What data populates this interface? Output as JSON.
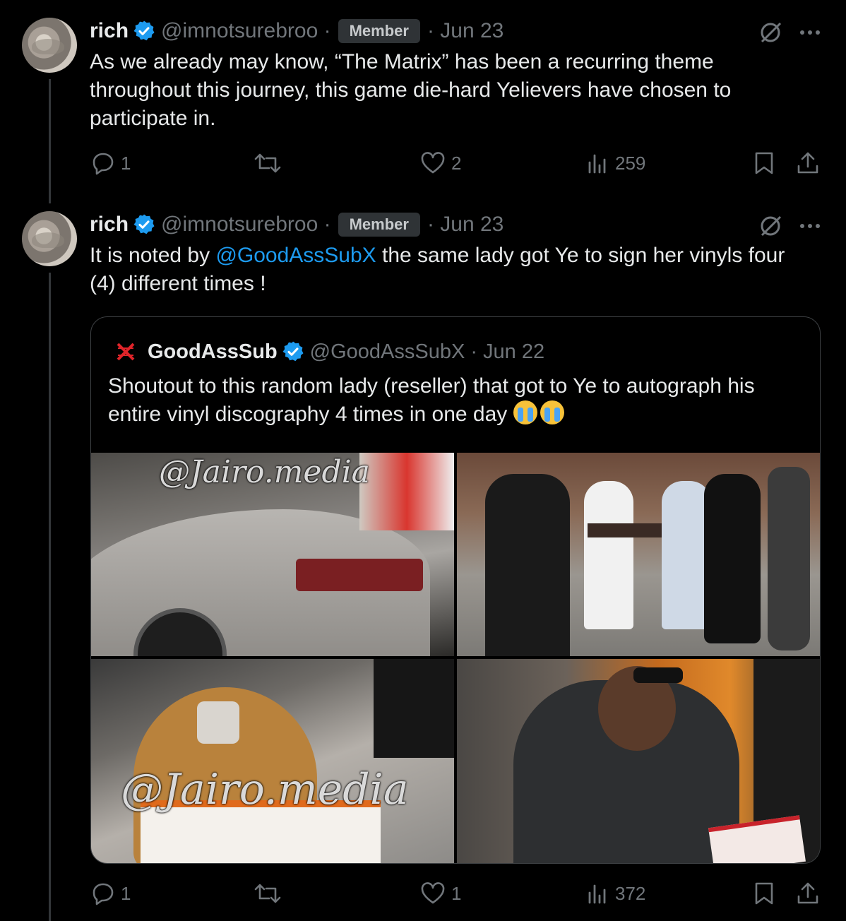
{
  "tweets": [
    {
      "name": "rich",
      "handle": "@imnotsurebroo ·",
      "badge": "Member",
      "date": "· Jun 23",
      "text": "As we already may know, “The Matrix” has been a recurring theme throughout this journey, this game die-hard Yelievers have chosen to participate in.",
      "replies": "1",
      "likes": "2",
      "views": "259"
    },
    {
      "name": "rich",
      "handle": "@imnotsurebroo ·",
      "badge": "Member",
      "date": "· Jun 23",
      "text_before": "It is noted by ",
      "mention": "@GoodAssSubX",
      "text_after": " the same lady got Ye to sign her vinyls four (4) different times !",
      "replies": "1",
      "likes": "1",
      "views": "372"
    }
  ],
  "quote": {
    "name": "GoodAssSub",
    "handle": "@GoodAssSubX",
    "date": "· Jun 22",
    "text": "Shoutout to this random lady (reseller) that got to Ye to autograph his entire vinyl discography 4 times in one day",
    "watermark_1": "@Jairo.media",
    "watermark_2": "@Jairo.media"
  },
  "icons": {
    "verified": "verified-badge-icon",
    "grok": "grok-icon",
    "more": "more-icon",
    "reply": "reply-icon",
    "retweet": "retweet-icon",
    "like": "like-icon",
    "views": "views-icon",
    "bookmark": "bookmark-icon",
    "share": "share-icon",
    "crying_emoji": "loudly-crying-face-icon"
  },
  "colors": {
    "background": "#000000",
    "text": "#e7e9ea",
    "muted": "#71767b",
    "link": "#1d9bf0",
    "verified": "#1d9bf0",
    "badge_bg": "#2f3336"
  }
}
